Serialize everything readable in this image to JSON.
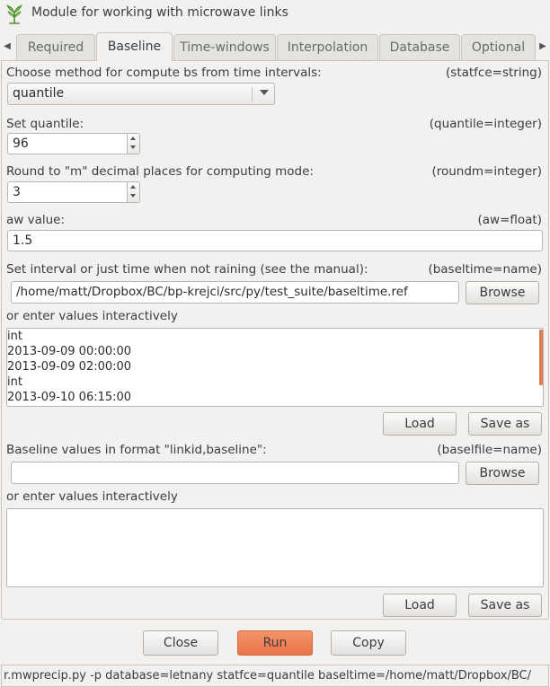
{
  "window": {
    "title": "Module for working with microwave links"
  },
  "icons": {
    "app": "grass-leaf-icon",
    "tab_prev": "arrow-left-icon",
    "tab_next": "arrow-right-icon"
  },
  "tabs": [
    {
      "label": "Required",
      "active": false
    },
    {
      "label": "Baseline",
      "active": true
    },
    {
      "label": "Time-windows",
      "active": false
    },
    {
      "label": "Interpolation",
      "active": false
    },
    {
      "label": "Database",
      "active": false
    },
    {
      "label": "Optional",
      "active": false
    }
  ],
  "statfce": {
    "label": "Choose method for compute bs from time intervals:",
    "key": "(statfce=string)",
    "value": "quantile"
  },
  "quantile": {
    "label": "Set quantile:",
    "key": "(quantile=integer)",
    "value": "96"
  },
  "roundm": {
    "label": "Round to \"m\" decimal places for computing mode:",
    "key": "(roundm=integer)",
    "value": "3"
  },
  "aw": {
    "label": "aw value:",
    "key": "(aw=float)",
    "value": "1.5"
  },
  "baseltime": {
    "label": "Set interval or just time when not raining (see the manual):",
    "key": "(baseltime=name)",
    "value": "/home/matt/Dropbox/BC/bp-krejci/src/py/test_suite/baseltime.ref",
    "browse_label": "Browse",
    "interactive_label": "or enter values interactively",
    "lines": [
      "int",
      "2013-09-09 00:00:00",
      "2013-09-09 02:00:00",
      "int",
      "2013-09-10 06:15:00"
    ],
    "load_label": "Load",
    "save_label": "Save as"
  },
  "baselfile": {
    "label": "Baseline values in format \"linkid,baseline\":",
    "key": "(baselfile=name)",
    "value": "",
    "browse_label": "Browse",
    "interactive_label": "or enter values interactively",
    "load_label": "Load",
    "save_label": "Save as"
  },
  "actions": {
    "close": "Close",
    "run": "Run",
    "copy": "Copy"
  },
  "command": "r.mwprecip.py -p database=letnany statfce=quantile baseltime=/home/matt/Dropbox/BC/",
  "colors": {
    "run_button": "#ea7448",
    "accent_scroll": "#e07a53",
    "background": "#f2f1f0"
  }
}
